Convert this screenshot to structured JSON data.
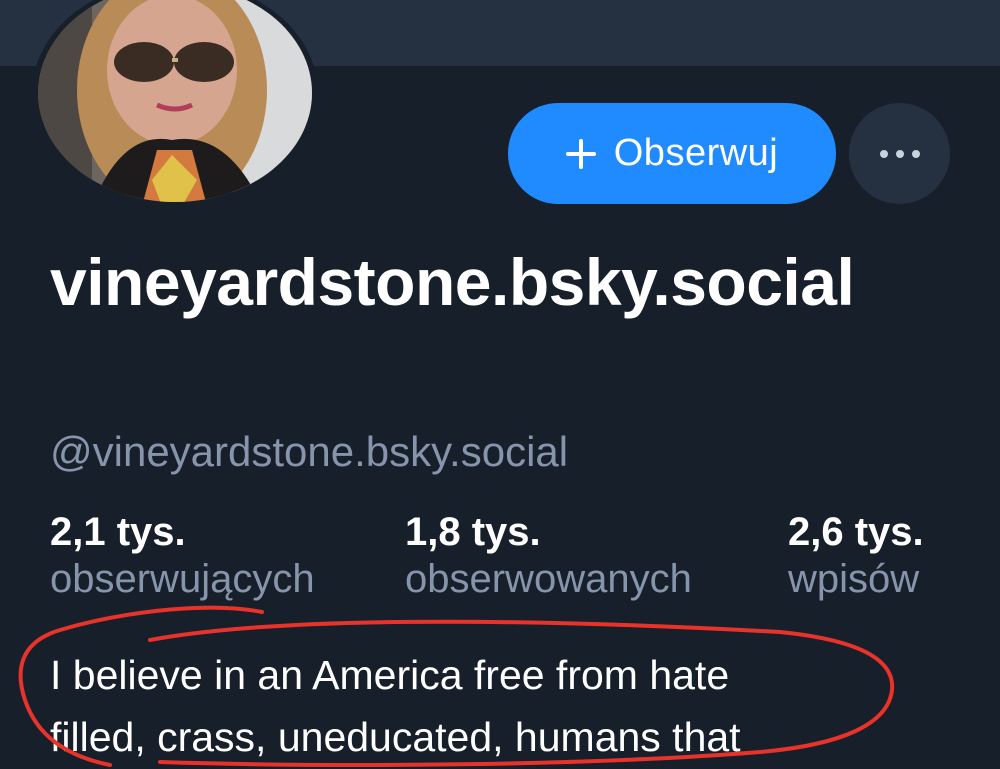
{
  "profile": {
    "display_name": "vineyardstone.bsky.social",
    "handle": "@vineyardstone.bsky.social",
    "avatar_icon": "avatar-photo",
    "bio": "I believe in an America free from hate\nfilled, crass, uneducated, humans that"
  },
  "actions": {
    "follow_label": "Obserwuj",
    "follow_icon": "plus-icon",
    "more_icon": "ellipsis-icon"
  },
  "stats": {
    "followers": {
      "count": "2,1 tys.",
      "label": "obserwujących"
    },
    "following": {
      "count": "1,8 tys.",
      "label": "obserwowanych"
    },
    "posts": {
      "count": "2,6 tys.",
      "label": "wpisów"
    }
  },
  "colors": {
    "background": "#171f2a",
    "banner": "#253041",
    "accent": "#208bfe",
    "secondary_text": "#8695ab",
    "annotation": "#e8332b"
  }
}
